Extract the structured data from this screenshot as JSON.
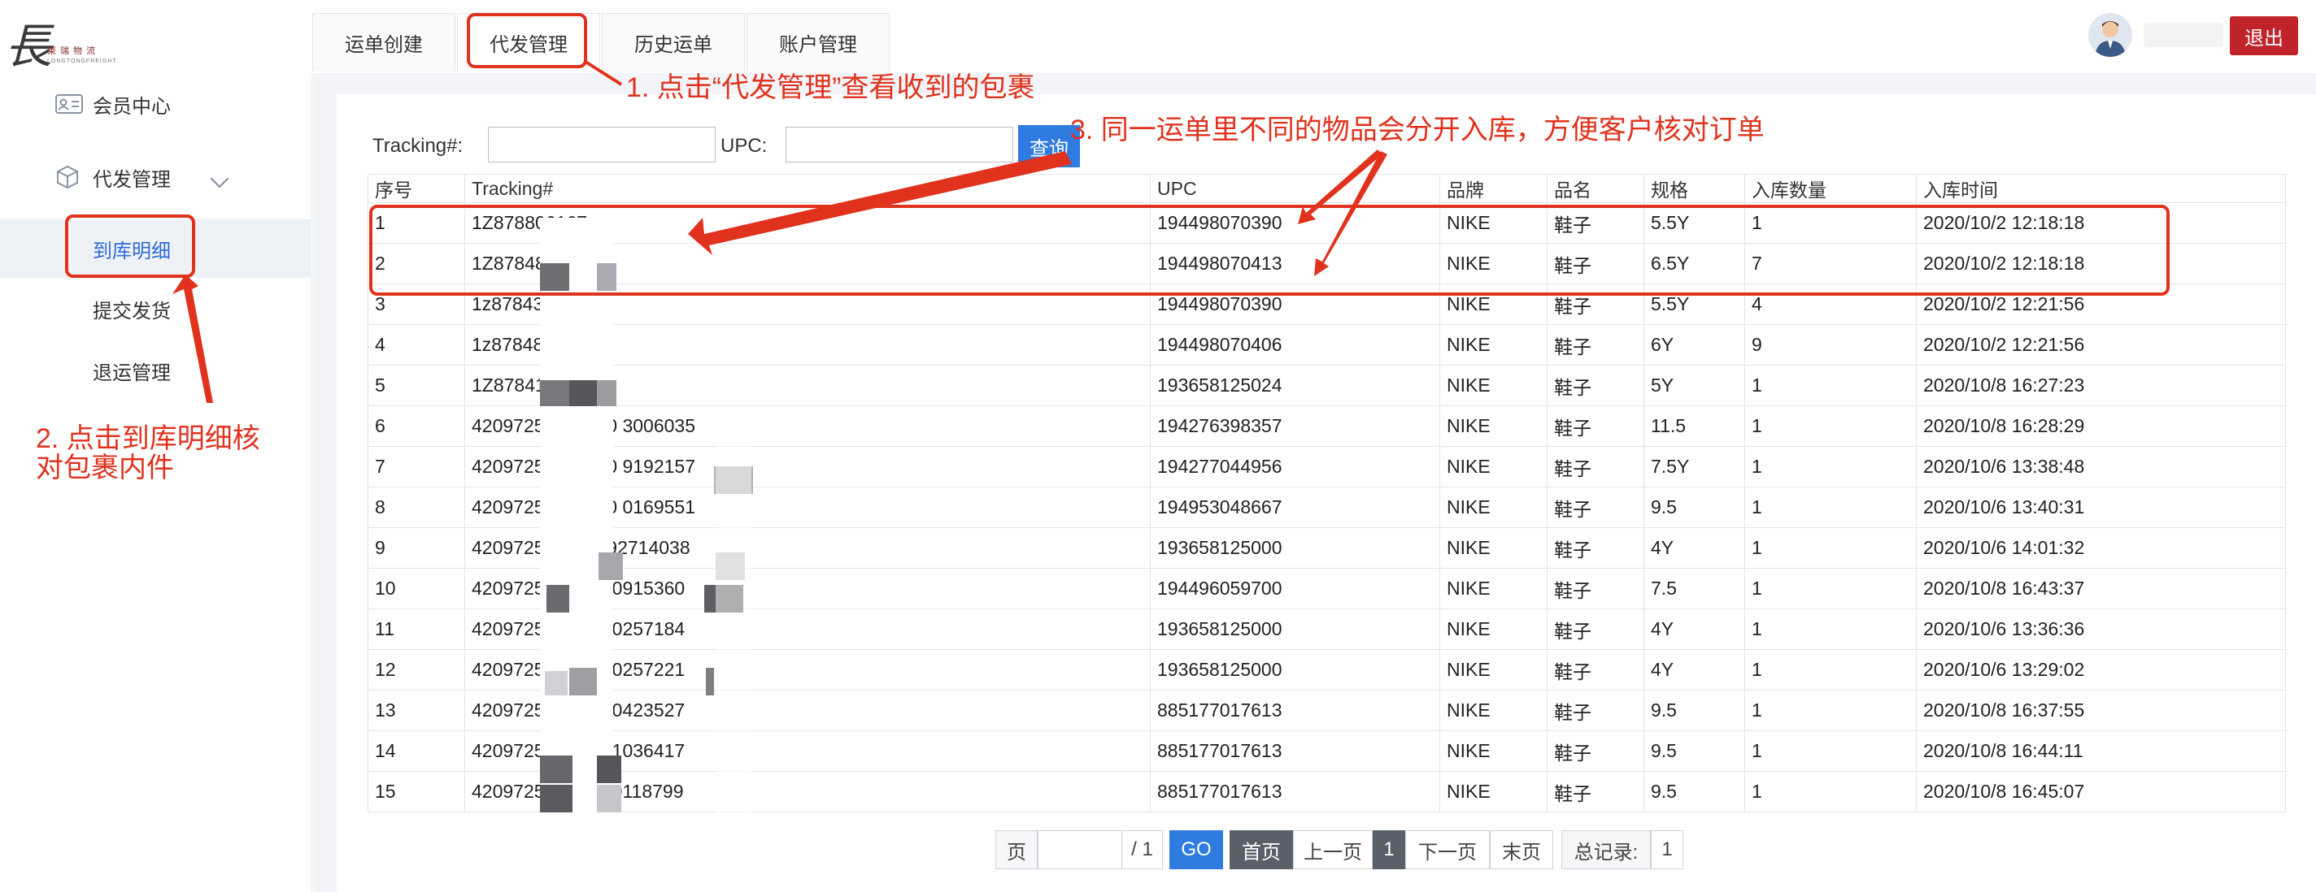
{
  "header": {
    "logo_text": "長",
    "logo_subtitle": "東 瑞 物 流",
    "logo_subtitle2": "LONGTONGFREIGHT",
    "tabs": [
      "运单创建",
      "代发管理",
      "历史运单",
      "账户管理"
    ],
    "logout_label": "退出"
  },
  "sidebar": {
    "member_center": "会员中心",
    "dropship_menu": "代发管理",
    "sub_items": [
      "到库明细",
      "提交发货",
      "退运管理"
    ]
  },
  "search": {
    "tracking_label": "Tracking#:",
    "upc_label": "UPC:",
    "tracking_value": "",
    "upc_value": "",
    "button_label": "查询"
  },
  "table": {
    "columns": [
      "序号",
      "Tracking#",
      "UPC",
      "品牌",
      "品名",
      "规格",
      "入库数量",
      "入库时间"
    ],
    "rows": [
      [
        "1",
        "1Z878806167",
        "194498070390",
        "NIKE",
        "鞋子",
        "5.5Y",
        "1",
        "2020/10/2 12:18:18"
      ],
      [
        "2",
        "1Z8784806167",
        "194498070413",
        "NIKE",
        "鞋子",
        "6.5Y",
        "7",
        "2020/10/2 12:18:18"
      ],
      [
        "3",
        "1z8784306318",
        "194498070390",
        "NIKE",
        "鞋子",
        "5.5Y",
        "4",
        "2020/10/2 12:21:56"
      ],
      [
        "4",
        "1z8784806318",
        "194498070406",
        "NIKE",
        "鞋子",
        "6Y",
        "9",
        "2020/10/2 12:21:56"
      ],
      [
        "5",
        "1Z8784140909",
        "193658125024",
        "NIKE",
        "鞋子",
        "5Y",
        "1",
        "2020/10/8 16:27:23"
      ],
      [
        "6",
        "42097259018780 3006035",
        "194276398357",
        "NIKE",
        "鞋子",
        "11.5",
        "1",
        "2020/10/8 16:28:29"
      ],
      [
        "7",
        "42097259018780 9192157",
        "194277044956",
        "NIKE",
        "鞋子",
        "7.5Y",
        "1",
        "2020/10/6 13:38:48"
      ],
      [
        "8",
        "42097259018780 0169551",
        "194953048667",
        "NIKE",
        "鞋子",
        "9.5",
        "1",
        "2020/10/6 13:40:31"
      ],
      [
        "9",
        "420972510200792714038",
        "193658125000",
        "NIKE",
        "鞋子",
        "4Y",
        "1",
        "2020/10/6 14:01:32"
      ],
      [
        "10",
        "4209725102008 0915360",
        "194496059700",
        "NIKE",
        "鞋子",
        "7.5",
        "1",
        "2020/10/8 16:43:37"
      ],
      [
        "11",
        "4209725102008 0257184",
        "193658125000",
        "NIKE",
        "鞋子",
        "4Y",
        "1",
        "2020/10/6 13:36:36"
      ],
      [
        "12",
        "4209725102008 0257221",
        "193658125000",
        "NIKE",
        "鞋子",
        "4Y",
        "1",
        "2020/10/6 13:29:02"
      ],
      [
        "13",
        "4209725102008 0423527",
        "885177017613",
        "NIKE",
        "鞋子",
        "9.5",
        "1",
        "2020/10/8 16:37:55"
      ],
      [
        "14",
        "4209725102008 1036417",
        "885177017613",
        "NIKE",
        "鞋子",
        "9.5",
        "1",
        "2020/10/8 16:44:11"
      ],
      [
        "15",
        "4209725102008 0118799",
        "885177017613",
        "NIKE",
        "鞋子",
        "9.5",
        "1",
        "2020/10/8 16:45:07"
      ]
    ]
  },
  "pagination": {
    "page_label": "页",
    "page_input": "",
    "total_pages": "/ 1",
    "go": "GO",
    "first": "首页",
    "prev": "上一页",
    "current": "1",
    "next": "下一页",
    "last": "末页",
    "total_label": "总记录:",
    "total_count": "1"
  },
  "annotations": {
    "note1": "1. 点击“代发管理”查看收到的包裹",
    "note2_line1": "2. 点击到库明细核",
    "note2_line2": "对包裹内件",
    "note3": "3. 同一运单里不同的物品会分开入库，方便客户核对订单"
  },
  "colors": {
    "accent_red": "#e0321d",
    "button_blue": "#2f7be0",
    "logout_red": "#c0232a",
    "active_menu_blue": "#2f6bd6"
  }
}
